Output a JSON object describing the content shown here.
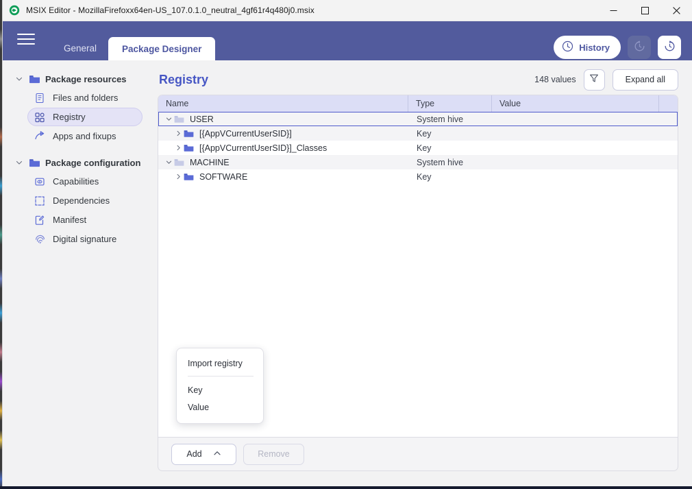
{
  "window": {
    "title": "MSIX Editor - MozillaFirefoxx64en-US_107.0.1.0_neutral_4gf61r4q480j0.msix",
    "app_icon": "msix-editor-logo-icon",
    "controls": {
      "minimize": "minimize-icon",
      "maximize": "maximize-icon",
      "close": "close-icon"
    }
  },
  "header": {
    "menu_icon": "hamburger-menu-icon",
    "accent_color": "#525b9d",
    "tabs": [
      {
        "label": "General",
        "active": false
      },
      {
        "label": "Package Designer",
        "active": true
      }
    ],
    "actions": {
      "history_label": "History",
      "history_icon": "clock-icon",
      "undo_icon": "undo-clock-icon",
      "undo_disabled": true,
      "redo_icon": "redo-clock-icon",
      "redo_disabled": false
    }
  },
  "sidebar": {
    "groups": [
      {
        "label": "Package resources",
        "icon": "folder-icon",
        "expanded": true,
        "items": [
          {
            "label": "Files and folders",
            "icon": "file-list-icon",
            "active": false
          },
          {
            "label": "Registry",
            "icon": "registry-blocks-icon",
            "active": true
          },
          {
            "label": "Apps and fixups",
            "icon": "arrow-curve-icon",
            "active": false
          }
        ]
      },
      {
        "label": "Package configuration",
        "icon": "folder-icon",
        "expanded": true,
        "items": [
          {
            "label": "Capabilities",
            "icon": "capability-icon",
            "active": false
          },
          {
            "label": "Dependencies",
            "icon": "dependency-frame-icon",
            "active": false
          },
          {
            "label": "Manifest",
            "icon": "manifest-pencil-icon",
            "active": false
          },
          {
            "label": "Digital signature",
            "icon": "fingerprint-icon",
            "active": false
          }
        ]
      }
    ]
  },
  "main": {
    "page_title": "Registry",
    "values_count": "148 values",
    "filter_icon": "filter-funnel-icon",
    "expand_all_label": "Expand all",
    "title_color": "#4656c4",
    "table": {
      "columns": [
        "Name",
        "Type",
        "Value"
      ],
      "rows": [
        {
          "name": "USER",
          "type": "System hive",
          "value": "",
          "indent": 0,
          "twisty": "expanded",
          "folder": "hive",
          "selected": true
        },
        {
          "name": "[{AppVCurrentUserSID}]",
          "type": "Key",
          "value": "",
          "indent": 1,
          "twisty": "collapsed",
          "folder": "key",
          "selected": false
        },
        {
          "name": "[{AppVCurrentUserSID}]_Classes",
          "type": "Key",
          "value": "",
          "indent": 1,
          "twisty": "collapsed",
          "folder": "key",
          "selected": false
        },
        {
          "name": "MACHINE",
          "type": "System hive",
          "value": "",
          "indent": 0,
          "twisty": "expanded",
          "folder": "hive",
          "selected": false
        },
        {
          "name": "SOFTWARE",
          "type": "Key",
          "value": "",
          "indent": 1,
          "twisty": "collapsed",
          "folder": "key",
          "selected": false
        }
      ]
    },
    "footer": {
      "add_label": "Add",
      "add_chevron": "chevron-up-icon",
      "remove_label": "Remove",
      "remove_disabled": true
    },
    "add_menu": {
      "open": true,
      "items": [
        {
          "label": "Import registry"
        },
        {
          "label": "Key"
        },
        {
          "label": "Value"
        }
      ]
    }
  }
}
